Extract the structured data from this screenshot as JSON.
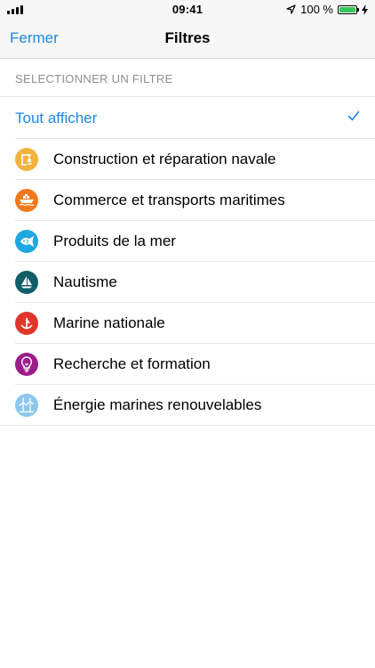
{
  "status_bar": {
    "time": "09:41",
    "battery": "100 %"
  },
  "nav": {
    "close_label": "Fermer",
    "title": "Filtres"
  },
  "section": {
    "header": "SELECTIONNER UN FILTRE"
  },
  "list": {
    "show_all": "Tout afficher",
    "items": [
      {
        "label": "Construction et réparation navale",
        "color": "#f2b33d",
        "icon": "crane-icon"
      },
      {
        "label": "Commerce et transports maritimes",
        "color": "#f07a1c",
        "icon": "cargo-ship-icon"
      },
      {
        "label": "Produits de la mer",
        "color": "#1ea8e0",
        "icon": "fish-icon"
      },
      {
        "label": "Nautisme",
        "color": "#0f5e68",
        "icon": "sailboat-icon"
      },
      {
        "label": "Marine nationale",
        "color": "#e0352b",
        "icon": "anchor-icon"
      },
      {
        "label": "Recherche et formation",
        "color": "#9b1d8a",
        "icon": "lightbulb-icon"
      },
      {
        "label": "Énergie marines renouvelables",
        "color": "#8cc8ee",
        "icon": "wind-turbine-icon"
      }
    ]
  }
}
